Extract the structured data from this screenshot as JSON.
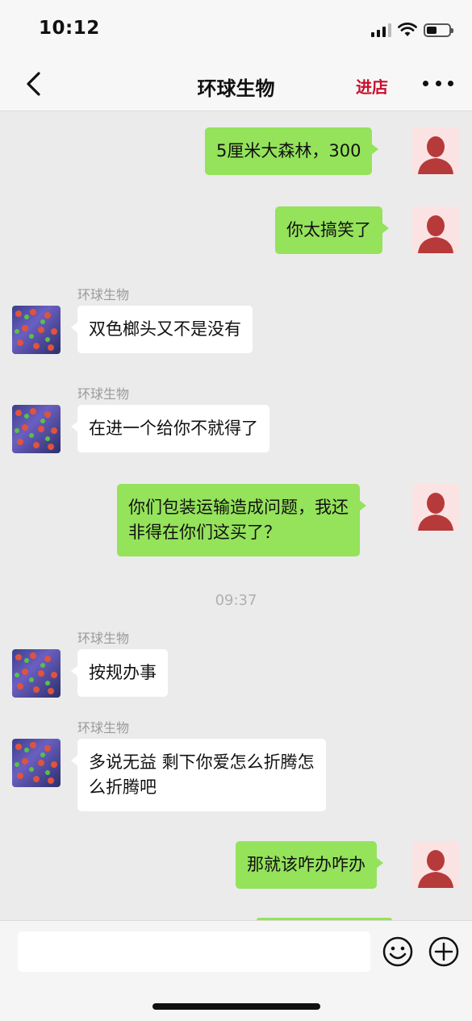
{
  "status": {
    "time": "10:12",
    "battery_level": 0.45
  },
  "nav": {
    "title": "环球生物",
    "enter_shop": "进店",
    "back_icon": "chevron-left-icon",
    "more_icon": "more-dots-icon"
  },
  "messages": [
    {
      "from": "me",
      "text": "5厘米大森林，300"
    },
    {
      "from": "me",
      "text": "你太搞笑了"
    },
    {
      "from": "shop",
      "sender": "环球生物",
      "text": "双色榔头又不是没有"
    },
    {
      "from": "shop",
      "sender": "环球生物",
      "text": "在进一个给你不就得了"
    },
    {
      "from": "me",
      "lines": [
        "你们包装运输造成问题，我还",
        "非得在你们这买了？"
      ]
    },
    {
      "from": "system",
      "text": "09:37"
    },
    {
      "from": "shop",
      "sender": "环球生物",
      "text": "按规办事"
    },
    {
      "from": "shop",
      "sender": "环球生物",
      "lines": [
        "多说无益 剩下你爱怎么折腾怎",
        "么折腾吧"
      ]
    },
    {
      "from": "me",
      "text": "那就该咋办咋办"
    }
  ],
  "input": {
    "value": "",
    "emoji_icon": "smiley-icon",
    "plus_icon": "plus-circle-icon"
  }
}
